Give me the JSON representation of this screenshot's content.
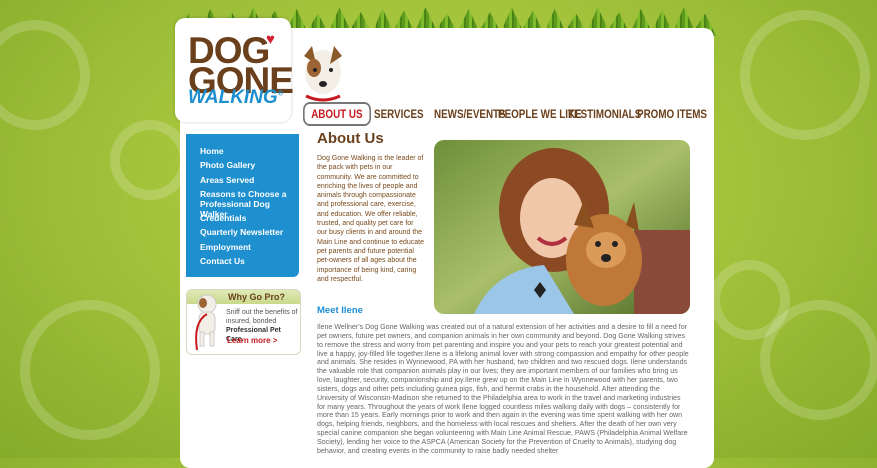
{
  "logo": {
    "line1": "DOG",
    "line2": "GONE",
    "line3": "WALKING",
    "reg": "®"
  },
  "nav": [
    {
      "label": "ABOUT US",
      "active": true
    },
    {
      "label": "SERVICES"
    },
    {
      "label": "NEWS/EVENTS"
    },
    {
      "label": "PEOPLE WE LIKE"
    },
    {
      "label": "TESTIMONIALS"
    },
    {
      "label": "PROMO ITEMS"
    }
  ],
  "sidebar": {
    "items": [
      "Home",
      "Photo Gallery",
      "Areas Served",
      "Reasons to Choose a Professional Dog Walker",
      "Credentials",
      "Quarterly Newsletter",
      "Employment",
      "Contact Us"
    ]
  },
  "promo": {
    "title": "Why Go Pro?",
    "text": "Sniff out the benefits of insured, bonded",
    "bold": "Professional Pet Care.",
    "link": "Learn more >"
  },
  "main": {
    "title": "About Us",
    "intro": "Dog Gone Walking is the leader of the pack with pets in our community. We are committed to enriching the lives of people and animals through compassionate and professional care, exercise, and education. We offer reliable, trusted, and quality pet care for our busy clients in and around the Main Line and continue to educate pet parents and future potential pet-owners of all ages about the importance of being kind, caring and respectful.",
    "subtitle": "Meet Ilene",
    "bio": "Ilene Wellner's Dog Gone Walking was created out of a natural extension of her activities and a desire to fill a need for pet owners, future pet owners, and companion animals in her own community and beyond. Dog Gone Walking strives to remove the stress and worry from pet parenting and inspire you and your pets to reach your greatest potential and live a happy, joy-filled life together.Ilene is a lifelong animal lover with strong compassion and empathy for other people and animals. She resides in Wynnewood, PA with her husband, two children and two rescued dogs. Ilene understands the valuable role that companion animals play in our lives; they are important members of our families who bring us love, laughter, security, companionship and joy.Ilene grew up on the Main Line in Wynnewood with her parents, two sisters, dogs and other pets including guinea pigs, fish, and hermit crabs in the household. After attending the University of Wisconsin-Madison she returned to the Philadelphia area to work in the travel and marketing industries for many years. Throughout the years of work Ilene logged countless miles walking daily with dogs – consistently for more than 15 years. Early mornings prior to work and then again in the evening was time spent walking with her own dogs, helping friends, neighbors, and the homeless with local rescues and shelters. After the death of her own very special canine companion she began volunteering with Main Line Animal Rescue, PAWS (Philadelphia Animal Welfare Society), lending her voice to the ASPCA (American Society for the Prevention of Cruelty to Animals), studying dog behavior, and creating events in the community to raise badly needed shelter"
  },
  "colors": {
    "brand_brown": "#6a3f1b",
    "brand_blue": "#1e8fcf",
    "accent_red": "#c6181e",
    "background_green": "#a4c43c"
  }
}
